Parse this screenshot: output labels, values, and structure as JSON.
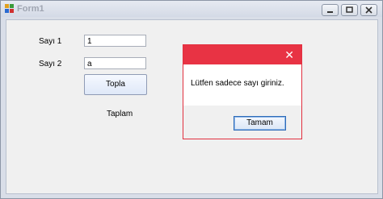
{
  "window": {
    "title": "Form1"
  },
  "form": {
    "sayi1_label": "Sayı 1",
    "sayi1_value": "1",
    "sayi2_label": "Sayı 2",
    "sayi2_value": "a",
    "topla_button": "Topla",
    "taplam_label": "Taplam"
  },
  "dialog": {
    "message": "Lütfen sadece sayı giriniz.",
    "ok_button": "Tamam",
    "close_glyph": "✕"
  },
  "colors": {
    "dialog_accent": "#e83344",
    "window_frame": "#d9dee8"
  }
}
